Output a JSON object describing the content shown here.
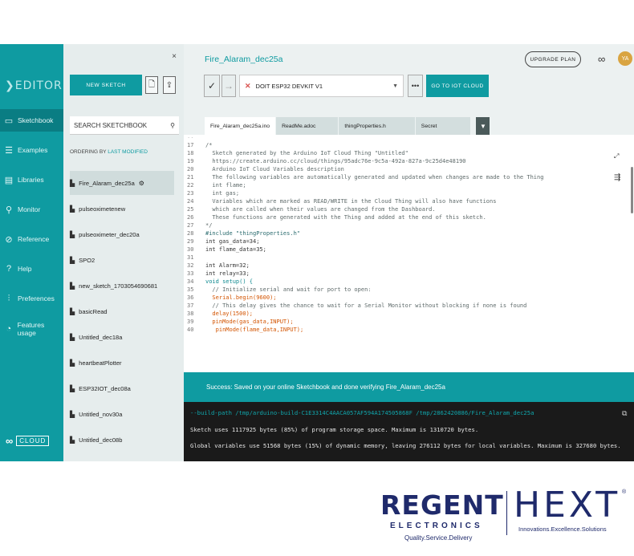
{
  "nav": {
    "brand": "EDITOR",
    "items": [
      {
        "label": "Sketchbook",
        "icon": "folder-icon"
      },
      {
        "label": "Examples",
        "icon": "examples-icon"
      },
      {
        "label": "Libraries",
        "icon": "libraries-icon"
      },
      {
        "label": "Monitor",
        "icon": "monitor-icon"
      },
      {
        "label": "Reference",
        "icon": "reference-icon"
      },
      {
        "label": "Help",
        "icon": "help-icon"
      },
      {
        "label": "Preferences",
        "icon": "preferences-icon"
      },
      {
        "label": "Features usage",
        "icon": "features-icon"
      }
    ],
    "cloud_label": "CLOUD"
  },
  "sketchbook": {
    "close": "×",
    "new_sketch": "NEW SKETCH",
    "search_placeholder": "SEARCH SKETCHBOOK",
    "order_prefix": "ORDERING BY",
    "order_value": "LAST MODIFIED",
    "items": [
      "Fire_Alaram_dec25a",
      "pulseoximetenew",
      "pulseoximeter_dec20a",
      "SPO2",
      "new_sketch_1703054690681",
      "basicRead",
      "Untitled_dec18a",
      "heartbeatPlotter",
      "ESP32IOT_dec08a",
      "Untitled_nov30a",
      "Untitled_dec08b"
    ]
  },
  "header": {
    "title": "Fire_Alaram_dec25a",
    "upgrade": "UPGRADE PLAN",
    "avatar": "YA",
    "board": "DOIT ESP32 DEVKIT V1",
    "goto": "GO TO IOT CLOUD"
  },
  "tabs": [
    "Fire_Alaram_dec25a.ino",
    "ReadMe.adoc",
    "thingProperties.h",
    "Secret"
  ],
  "code": {
    "lines": [
      {
        "n": "17",
        "t": "/*"
      },
      {
        "n": "18",
        "t": "  Sketch generated by the Arduino IoT Cloud Thing \"Untitled\""
      },
      {
        "n": "19",
        "t": "  https://create.arduino.cc/cloud/things/95adc76e-9c5a-492a-827a-9c25d4e48190"
      },
      {
        "n": "20",
        "t": "  Arduino IoT Cloud Variables description"
      },
      {
        "n": "21",
        "t": "  The following variables are automatically generated and updated when changes are made to the Thing"
      },
      {
        "n": "22",
        "t": "  int flame;"
      },
      {
        "n": "23",
        "t": "  int gas;"
      },
      {
        "n": "24",
        "t": "  Variables which are marked as READ/WRITE in the Cloud Thing will also have functions"
      },
      {
        "n": "25",
        "t": "  which are called when their values are changed from the Dashboard."
      },
      {
        "n": "26",
        "t": "  These functions are generated with the Thing and added at the end of this sketch."
      },
      {
        "n": "27",
        "t": "*/"
      },
      {
        "n": "28",
        "t": "#include \"thingProperties.h\""
      },
      {
        "n": "29",
        "t": "int gas_data=34;"
      },
      {
        "n": "30",
        "t": "int flame_data=35;"
      },
      {
        "n": "31",
        "t": ""
      },
      {
        "n": "32",
        "t": "int Alarm=32;"
      },
      {
        "n": "33",
        "t": "int relay=33;"
      },
      {
        "n": "34",
        "t": "void setup() {"
      },
      {
        "n": "35",
        "t": "  // Initialize serial and wait for port to open:"
      },
      {
        "n": "36",
        "t": "  Serial.begin(9600);"
      },
      {
        "n": "37",
        "t": "  // This delay gives the chance to wait for a Serial Monitor without blocking if none is found"
      },
      {
        "n": "38",
        "t": "  delay(1500);"
      },
      {
        "n": "39",
        "t": "  pinMode(gas_data,INPUT);"
      },
      {
        "n": "40",
        "t": "   pinMode(flame_data,INPUT);"
      }
    ]
  },
  "status": {
    "success": "Success: Saved on your online Sketchbook and done verifying Fire_Alaram_dec25a",
    "console": [
      "--build-path /tmp/arduino-build-C1E3314C4AACA057AF594A174505868F /tmp/2862420886/Fire_Alaram_dec25a",
      "Sketch uses 1117925 bytes (85%) of program storage space. Maximum is 1310720 bytes.",
      "Global variables use 51568 bytes (15%) of dynamic memory, leaving 276112 bytes for local variables. Maximum is 327680 bytes."
    ]
  },
  "footer": {
    "regent": "REGENT",
    "electronics": "ELECTRONICS",
    "regent_tag": "Quality.Service.Delivery",
    "hext": "HEXT",
    "hext_tag": "Innovations.Excellence.Solutions",
    "reg": "®"
  },
  "colors": {
    "teal": "#0f9ba1",
    "navy": "#1f2a6b",
    "error": "#d9534f"
  }
}
